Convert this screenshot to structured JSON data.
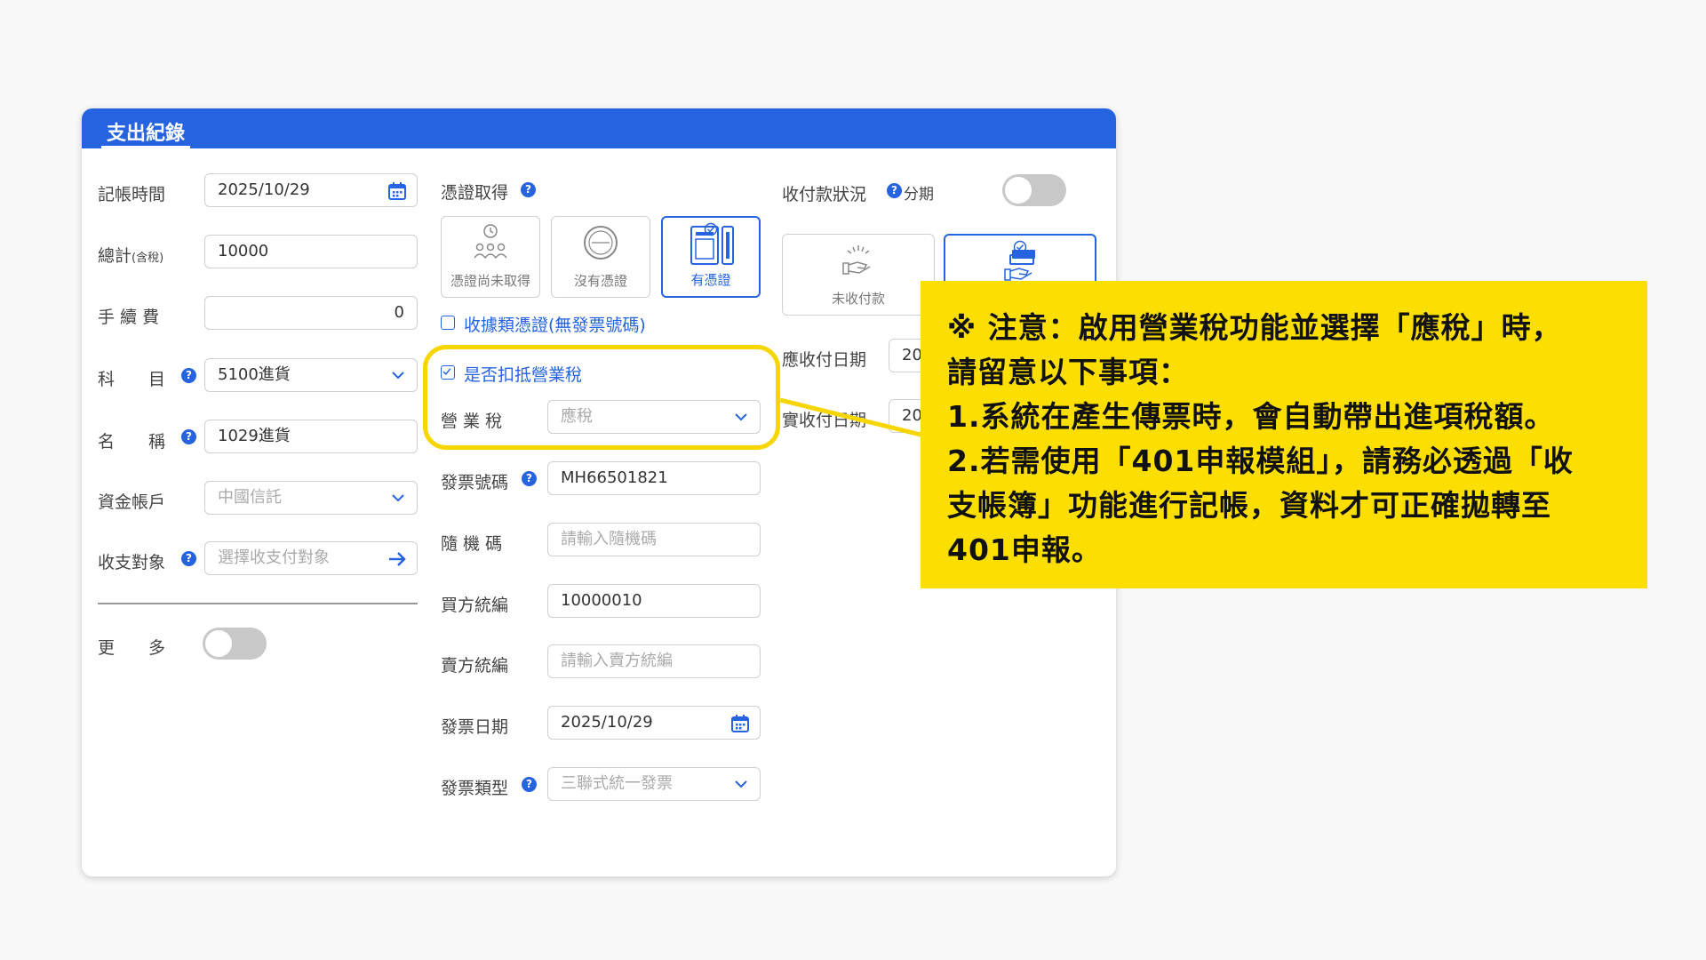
{
  "panel": {
    "title": "支出紀錄"
  },
  "col1": {
    "date_label": "記帳時間",
    "date_value": "2025/10/29",
    "total_label": "總計",
    "total_suffix": "(含稅)",
    "total_value": "10000",
    "fee_label": "手 續 費",
    "fee_value": "0",
    "subject_label": "科　　目",
    "subject_value": "5100進貨",
    "name_label": "名　　稱",
    "name_value": "1029進貨",
    "account_label": "資金帳戶",
    "account_value": "中國信託",
    "party_label": "收支對象",
    "party_placeholder": "選擇收支付對象",
    "more_label": "更　　多"
  },
  "col2": {
    "voucher_label": "憑證取得",
    "tiles": [
      "憑證尚未取得",
      "沒有憑證",
      "有憑證"
    ],
    "receipt_checkbox": "收據類憑證(無發票號碼)",
    "tax_checkbox": "是否扣抵營業稅",
    "tax_label": "營 業 稅",
    "tax_value": "應稅",
    "invoice_no_label": "發票號碼",
    "invoice_no_value": "MH66501821",
    "random_label": "隨 機 碼",
    "random_placeholder": "請輸入隨機碼",
    "buyer_label": "買方統編",
    "buyer_value": "10000010",
    "seller_label": "賣方統編",
    "seller_placeholder": "請輸入賣方統編",
    "invoice_date_label": "發票日期",
    "invoice_date_value": "2025/10/29",
    "invoice_type_label": "發票類型",
    "invoice_type_value": "三聯式統一發票"
  },
  "col3": {
    "status_label": "收付款狀況",
    "installment_label": "分期",
    "tiles": [
      "未收付款"
    ],
    "due_label": "應收付日期",
    "due_value": "20",
    "paid_label": "實收付日期",
    "paid_value": "20"
  },
  "note": {
    "lines": [
      "※ 注意：啟用營業稅功能並選擇「應稅」時，",
      "請留意以下事項：",
      "1.系統在產生傳票時，會自動帶出進項稅額。",
      "2.若需使用「401申報模組」，請務必透過「收",
      "支帳簿」功能進行記帳，資料才可正確拋轉至",
      "401申報。"
    ]
  },
  "colors": {
    "primary": "#2563e0",
    "highlight": "#fcdf00"
  },
  "icons": [
    "calendar-icon",
    "chevron-down-icon",
    "arrow-right-icon",
    "help-icon",
    "check-icon"
  ]
}
